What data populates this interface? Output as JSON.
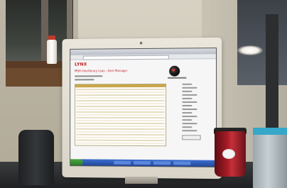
{
  "photo": {
    "monitor_screen": {
      "logo_text": "LYNX",
      "page_title": "MSH Interlibrary Loan - Item Manager",
      "table": {
        "visible_rows": 20
      }
    }
  },
  "colors": {
    "sky_border": "#7fc8ea",
    "monitor_bezel": "#e6e2d8",
    "mug_red": "#a41b25",
    "table_header": "#c9a64a",
    "logo_red": "#c21818"
  }
}
